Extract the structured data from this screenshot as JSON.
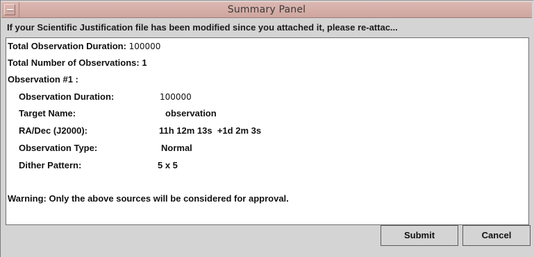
{
  "window": {
    "title": "Summary Panel"
  },
  "notice": "If your Scientific Justification file has been modified since you attached it, please re-attac...",
  "summary": {
    "total_duration_label": "Total Observation Duration:",
    "total_duration_value": "100000",
    "total_count_label": "Total Number of Observations:",
    "total_count_value": "1",
    "observation_header": "Observation #1 :",
    "observation": {
      "duration_label": "Observation Duration:",
      "duration_value": "100000",
      "target_label": "Target Name:",
      "target_value": "observation",
      "radec_label": "RA/Dec (J2000):",
      "radec_value": "11h 12m 13s  +1d 2m 3s",
      "type_label": "Observation Type:",
      "type_value": "Normal",
      "dither_label": "Dither Pattern:",
      "dither_value": "5 x 5"
    },
    "warning": "Warning: Only the above sources will be considered for approval."
  },
  "buttons": {
    "submit": "Submit",
    "cancel": "Cancel"
  },
  "icons": {
    "window_menu": "window-menu-icon"
  },
  "colors": {
    "titlebar": "#cfa69f",
    "background": "#d4d4d4",
    "panel": "#ffffff"
  }
}
